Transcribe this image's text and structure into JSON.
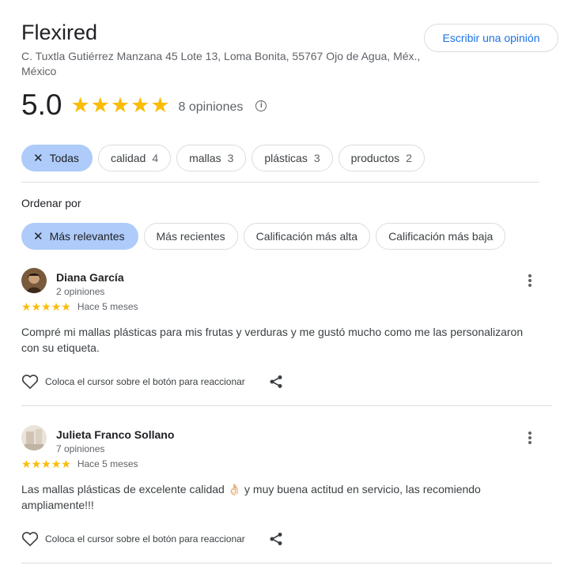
{
  "business": {
    "name": "Flexired",
    "address": "C. Tuxtla Gutiérrez Manzana 45 Lote 13, Loma Bonita, 55767 Ojo de Agua, Méx., México",
    "write_review_label": "Escribir una opinión",
    "rating": "5.0",
    "rating_stars": 5,
    "review_count_label": "8 opiniones",
    "info_icon": "info-icon"
  },
  "filters": [
    {
      "label": "Todas",
      "count": "",
      "active": true
    },
    {
      "label": "calidad",
      "count": "4",
      "active": false
    },
    {
      "label": "mallas",
      "count": "3",
      "active": false
    },
    {
      "label": "plásticas",
      "count": "3",
      "active": false
    },
    {
      "label": "productos",
      "count": "2",
      "active": false
    }
  ],
  "sort": {
    "label": "Ordenar por",
    "options": [
      {
        "label": "Más relevantes",
        "active": true
      },
      {
        "label": "Más recientes",
        "active": false
      },
      {
        "label": "Calificación más alta",
        "active": false
      },
      {
        "label": "Calificación más baja",
        "active": false
      }
    ]
  },
  "reviews": [
    {
      "name": "Diana García",
      "count": "2 opiniones",
      "stars": 5,
      "time": "Hace 5 meses",
      "text": "Compré mi mallas plásticas para mis frutas y verduras y me gustó mucho como me las personalizaron con su etiqueta.",
      "react_label": "Coloca el cursor sobre el botón para reaccionar"
    },
    {
      "name": "Julieta Franco Sollano",
      "count": "7 opiniones",
      "stars": 5,
      "time": "Hace 5 meses",
      "text": "Las mallas plásticas de excelente calidad 👌🏻 y muy buena actitud en servicio, las recomiendo ampliamente!!!",
      "react_label": "Coloca el cursor sobre el botón para reaccionar"
    }
  ],
  "colors": {
    "accent": "#1a73e8",
    "star": "#fbbc04",
    "chip_active": "#aecbfa",
    "divider": "#dadce0"
  }
}
